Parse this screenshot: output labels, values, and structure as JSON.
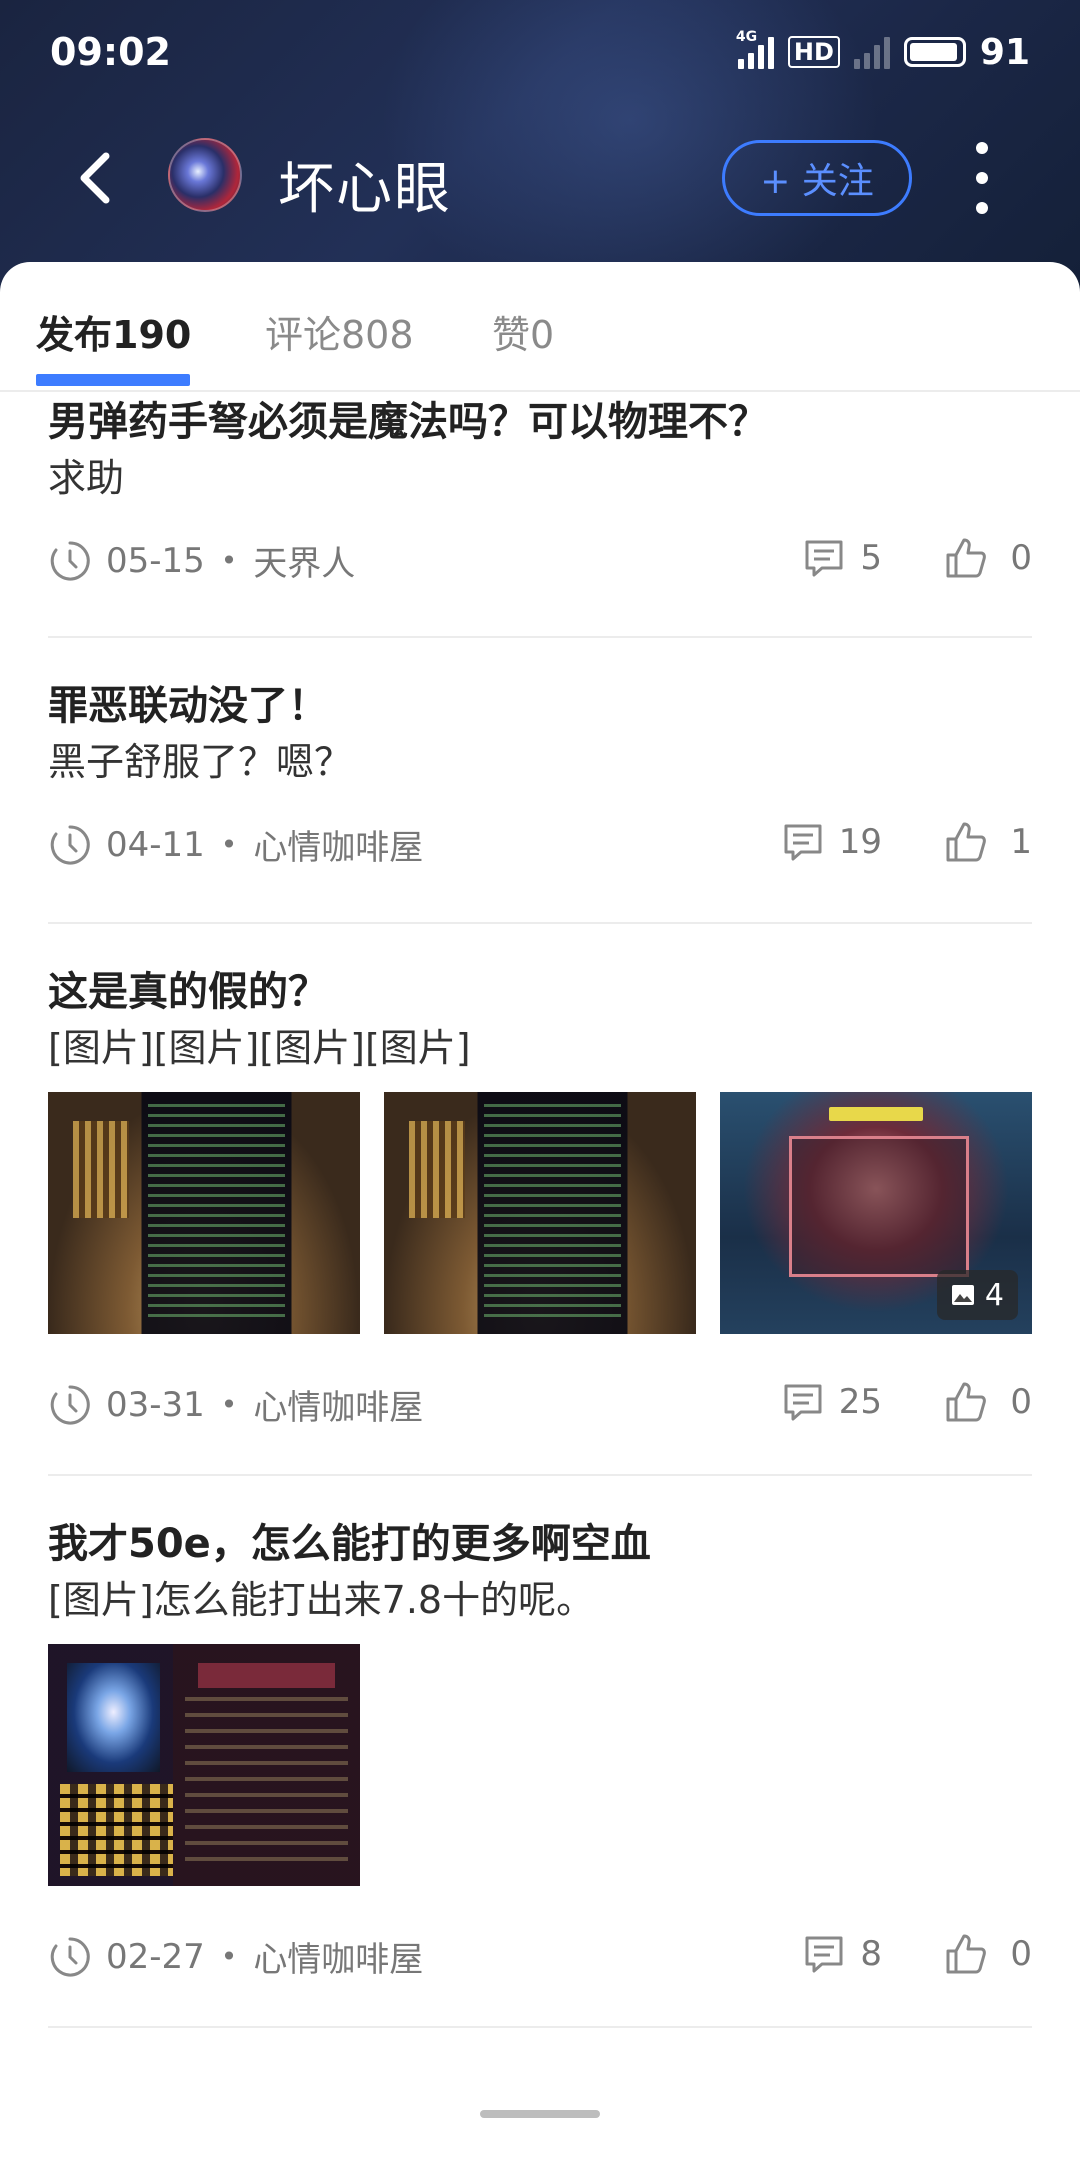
{
  "status_bar": {
    "time": "09:02",
    "network_tag": "4G",
    "hd_label": "HD",
    "battery": "91"
  },
  "nav": {
    "title": "坏心眼",
    "follow_label": "+ 关注"
  },
  "tabs": [
    {
      "label": "发布190",
      "active": true
    },
    {
      "label": "评论808",
      "active": false
    },
    {
      "label": "赞0",
      "active": false
    }
  ],
  "posts": [
    {
      "title": "男弹药手弩必须是魔法吗？可以物理不？",
      "body": "求助",
      "date": "05-15",
      "forum": "天界人",
      "comments": "5",
      "likes": "0"
    },
    {
      "title": "罪恶联动没了！",
      "body": "黑子舒服了？嗯？",
      "date": "04-11",
      "forum": "心情咖啡屋",
      "comments": "19",
      "likes": "1"
    },
    {
      "title": "这是真的假的？",
      "body": "[图片][图片][图片][图片]",
      "date": "03-31",
      "forum": "心情咖啡屋",
      "comments": "25",
      "likes": "0",
      "image_count": "4"
    },
    {
      "title": "我才50e，怎么能打的更多啊空血",
      "body": "[图片]怎么能打出来7.8十的呢。",
      "date": "02-27",
      "forum": "心情咖啡屋",
      "comments": "8",
      "likes": "0"
    }
  ],
  "colors": {
    "accent": "#3d7cff",
    "header_bg": "#1f2b4c",
    "meta_text": "#777777"
  }
}
